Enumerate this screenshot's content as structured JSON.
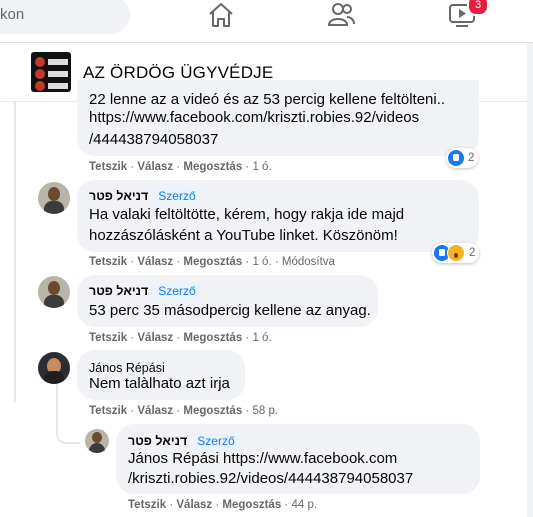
{
  "nav": {
    "search_placeholder": "kon",
    "icons": [
      "home-icon",
      "groups-icon",
      "watch-icon"
    ],
    "watch_badge": "3"
  },
  "group": {
    "title": "AZ ÖRDÖG ÜGYVÉDJE"
  },
  "actions": {
    "like": "Tetszik",
    "reply": "Válasz",
    "share": "Megosztás",
    "edited": "Módosítva"
  },
  "author_badge": "Szerző",
  "comments": [
    {
      "text_cut": "22 lenne az a videó és az 53 percig kellene feltölteni..",
      "text": "https://www.facebook.com/kriszti.robies.92/videos/444438794058037",
      "line1": "https://www.facebook.com/kriszti.robies.92/videos",
      "line2": "/444438794058037",
      "time": "1 ó.",
      "reactions": "2"
    },
    {
      "author": "דניאל פטר",
      "line1": "Ha valaki feltöltötte, kérem, hogy rakja ide majd",
      "line2": "hozzászólásként a YouTube linket. Köszönöm!",
      "time": "1 ó.",
      "reactions": "2"
    },
    {
      "author": "דניאל פטר",
      "text": "53 perc 35 másodpercig kellene az anyag.",
      "time": "1 ó."
    },
    {
      "author": "János Répási",
      "text": "Nem talàlhato azt irja",
      "time": "58 p."
    },
    {
      "author": "דניאל פטר",
      "line1": "János Répási https://www.facebook.com",
      "line2": "/kriszti.robies.92/videos/444438794058037",
      "time": "44 p."
    }
  ]
}
